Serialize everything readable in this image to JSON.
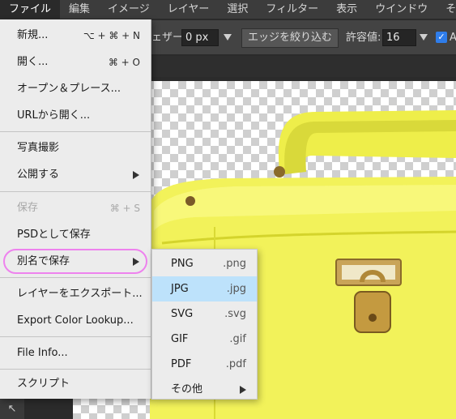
{
  "menubar": {
    "items": [
      "ファイル",
      "編集",
      "イメージ",
      "レイヤー",
      "選択",
      "フィルター",
      "表示",
      "ウインドウ",
      "その他"
    ]
  },
  "options_bar": {
    "feather_label": "ェザー:",
    "feather_value": "0 px",
    "refine_edge_button": "エッジを絞り込む",
    "tolerance_label": "許容値:",
    "tolerance_value": "16",
    "antialias_label": "A"
  },
  "file_menu": {
    "items": [
      {
        "label": "新規...",
        "shortcut": "⌥ + ⌘ + N"
      },
      {
        "label": "開く...",
        "shortcut": "⌘ + O"
      },
      {
        "label": "オープン＆プレース..."
      },
      {
        "label": "URLから開く..."
      },
      {
        "label": "写真撮影"
      },
      {
        "label": "公開する"
      },
      {
        "label": "保存",
        "shortcut": "⌘ + S",
        "disabled": true
      },
      {
        "label": "PSDとして保存"
      },
      {
        "label": "別名で保存"
      },
      {
        "label": "レイヤーをエクスポート..."
      },
      {
        "label": "Export Color Lookup..."
      },
      {
        "label": "File Info..."
      },
      {
        "label": "スクリプト"
      }
    ]
  },
  "save_as_submenu": {
    "items": [
      {
        "label": "PNG",
        "ext": ".png"
      },
      {
        "label": "JPG",
        "ext": ".jpg",
        "highlighted": true
      },
      {
        "label": "SVG",
        "ext": ".svg"
      },
      {
        "label": "GIF",
        "ext": ".gif"
      },
      {
        "label": "PDF",
        "ext": ".pdf"
      },
      {
        "label": "その他"
      }
    ]
  },
  "colors": {
    "menu_bg": "#ececec",
    "highlight": "#bde2fb",
    "annotation_ring": "#ee82ee",
    "bag_yellow": "#f2f25a"
  },
  "icons": {
    "arrow_tool": "pointer-arrow-icon",
    "submenu_arrow": "chevron-right-icon",
    "checkbox": "checkbox-checked-icon"
  }
}
